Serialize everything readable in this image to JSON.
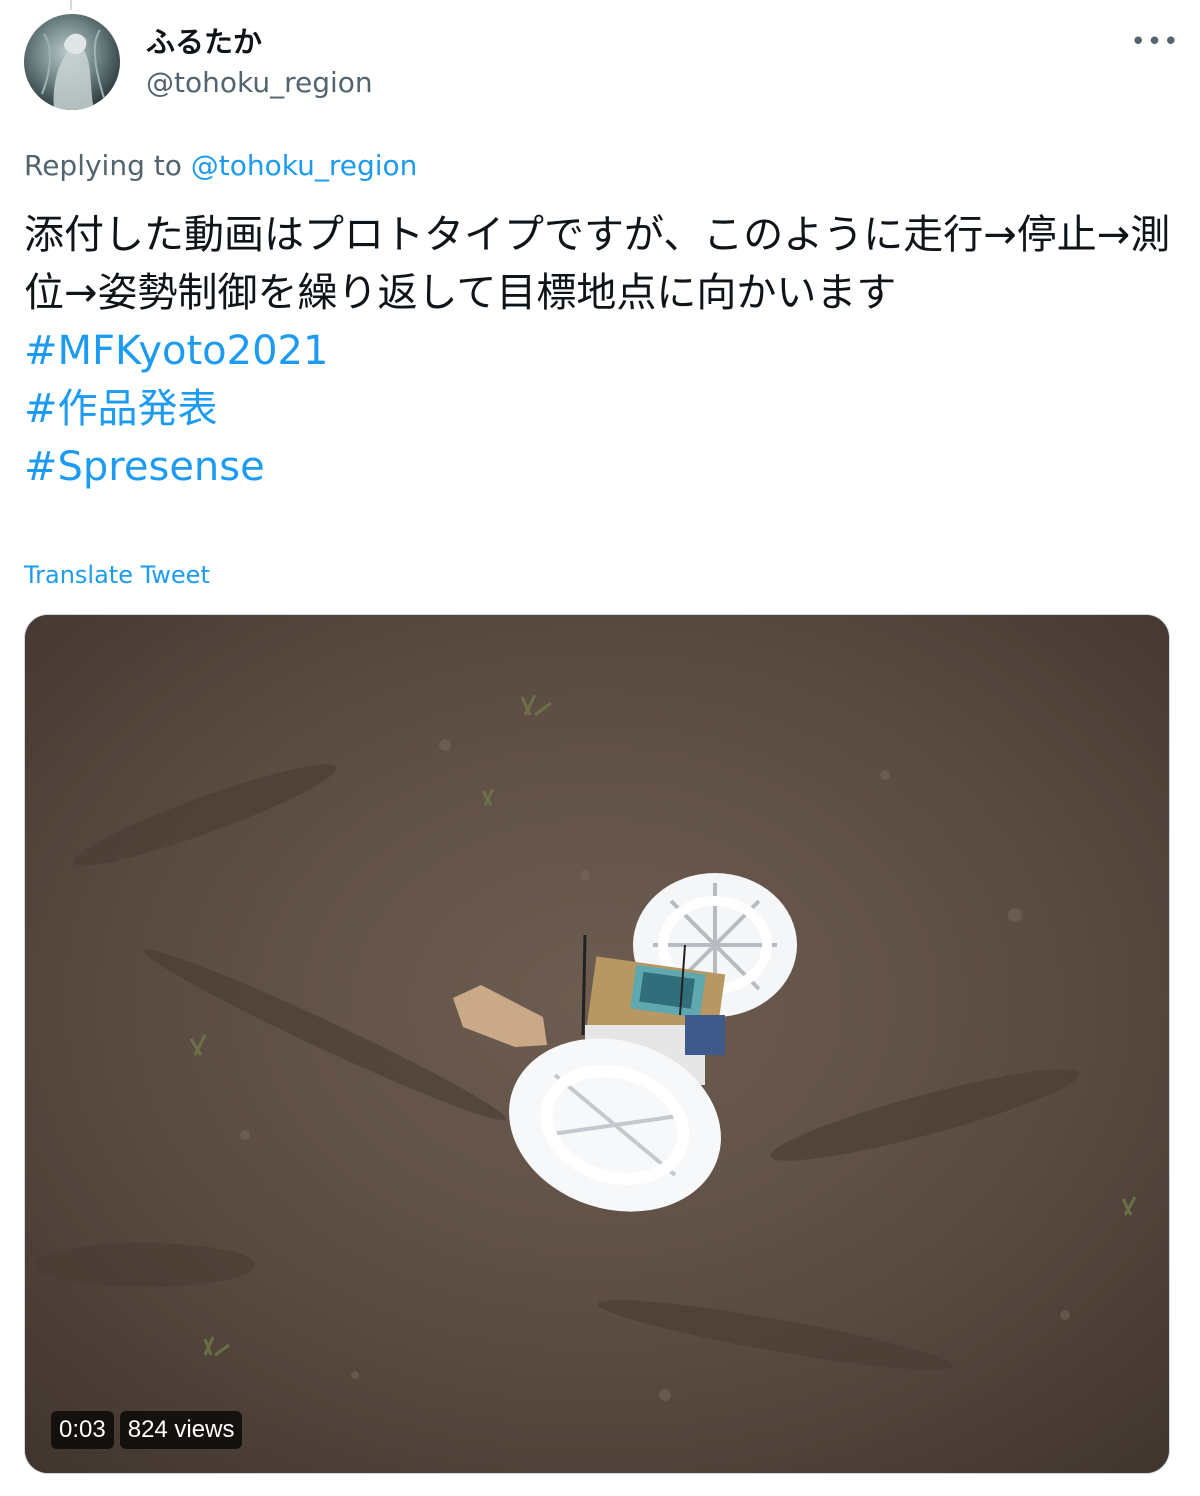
{
  "author": {
    "display_name": "ふるたか",
    "handle": "@tohoku_region"
  },
  "reply": {
    "prefix": "Replying to",
    "to_handle": "@tohoku_region"
  },
  "tweet": {
    "body": "添付した動画はプロトタイプですが、このように走行→停止→測位→姿勢制御を繰り返して目標地点に向かいます",
    "hashtags": [
      "#MFKyoto2021",
      "#作品発表",
      "#Spresense"
    ],
    "translate_label": "Translate Tweet"
  },
  "video": {
    "duration": "0:03",
    "views": "824 views"
  },
  "icons": {
    "more": "more-horizontal-icon"
  },
  "colors": {
    "link": "#1d9bf0",
    "secondary_text": "#536471",
    "primary_text": "#0f1419"
  }
}
